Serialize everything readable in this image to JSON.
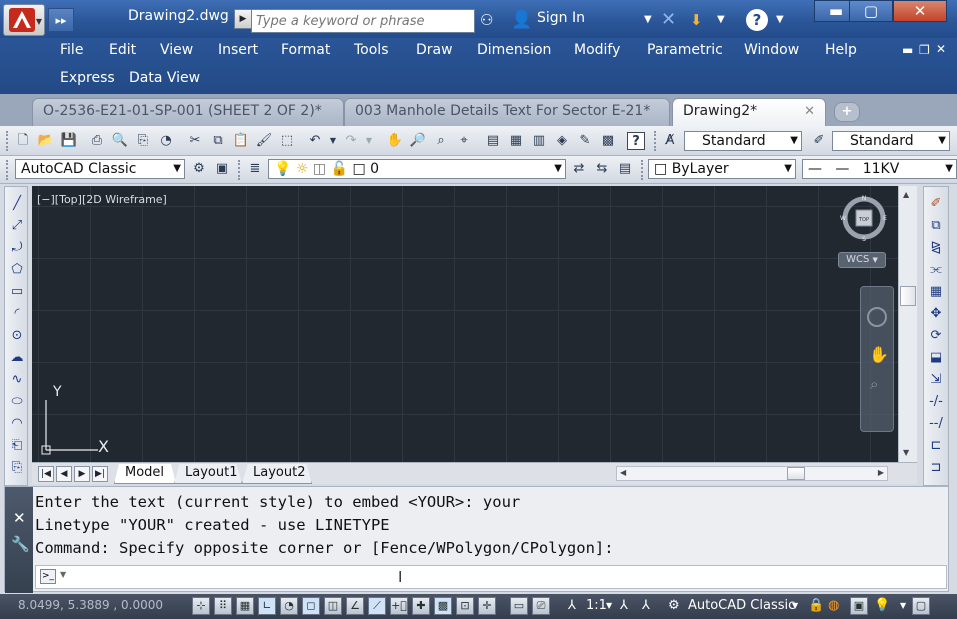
{
  "titlebar": {
    "document_title": "Drawing2.dwg",
    "search_placeholder": "Type a keyword or phrase",
    "sign_in_label": "Sign In"
  },
  "menu": {
    "row1": [
      "File",
      "Edit",
      "View",
      "Insert",
      "Format",
      "Tools",
      "Draw",
      "Dimension",
      "Modify",
      "Parametric",
      "Window",
      "Help"
    ],
    "row2": [
      "Express",
      "Data View"
    ]
  },
  "doc_tabs": [
    {
      "label": "O-2536-E21-01-SP-001 (SHEET 2 OF 2)*",
      "active": false
    },
    {
      "label": "003 Manhole Details Text For Sector E-21*",
      "active": false
    },
    {
      "label": "Drawing2*",
      "active": true
    }
  ],
  "toolbar1": {
    "text_style": "Standard",
    "dim_style": "Standard"
  },
  "toolbar2": {
    "workspace": "AutoCAD Classic",
    "layer": "0",
    "color": "ByLayer",
    "linetype": "11KV"
  },
  "viewport": {
    "label": "[−][Top][2D Wireframe]",
    "viewcube_top": "TOP",
    "compass": {
      "n": "N",
      "s": "S",
      "e": "E",
      "w": "W"
    },
    "wcs_label": "WCS",
    "ucs_x": "X",
    "ucs_y": "Y"
  },
  "layout_tabs": [
    "Model",
    "Layout1",
    "Layout2"
  ],
  "command_line": {
    "history": [
      "Enter the text (current style) to embed <YOUR>: your",
      "Linetype \"YOUR\" created - use LINETYPE",
      "Command: Specify opposite corner or [Fence/WPolygon/CPolygon]:"
    ],
    "input_value": ""
  },
  "statusbar": {
    "coordinates": "8.0499, 5.3889 , 0.0000",
    "annotation_scale": "1:1",
    "workspace": "AutoCAD Classic"
  },
  "colors": {
    "title_blue": "#2a5597",
    "canvas_bg": "#212830",
    "close_red": "#c3432a"
  }
}
